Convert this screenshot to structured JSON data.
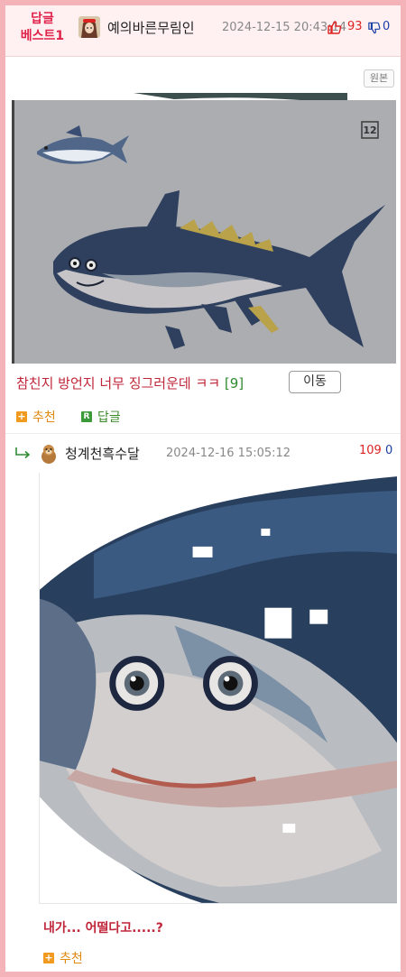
{
  "header": {
    "badge_line1": "답글",
    "badge_line2": "베스트1",
    "author": "예의바른무림인",
    "date": "2024-12-15 20:43:14",
    "upvotes": "93",
    "downvotes": "0"
  },
  "post": {
    "original_button": "원본",
    "image_badge": "12",
    "caption": "참친지 방언지 너무 징그러운데 ㅋㅋ",
    "comment_count": "[9]",
    "move_button": "이동",
    "recommend_label": "추천",
    "reply_label": "답글",
    "reply_icon_letter": "R"
  },
  "reply": {
    "author": "청계천흑수달",
    "date": "2024-12-16 15:05:12",
    "upvotes": "109",
    "downvotes": "0",
    "caption": "내가... 어떨다고.....?",
    "recommend_label": "추천"
  },
  "colors": {
    "frame": "#f4b3b9",
    "badge_red": "#e0234a",
    "caption_red": "#c0263a",
    "count_green": "#2f8a30",
    "recommend_orange": "#f19a1f",
    "reply_green": "#3d9a3a"
  }
}
